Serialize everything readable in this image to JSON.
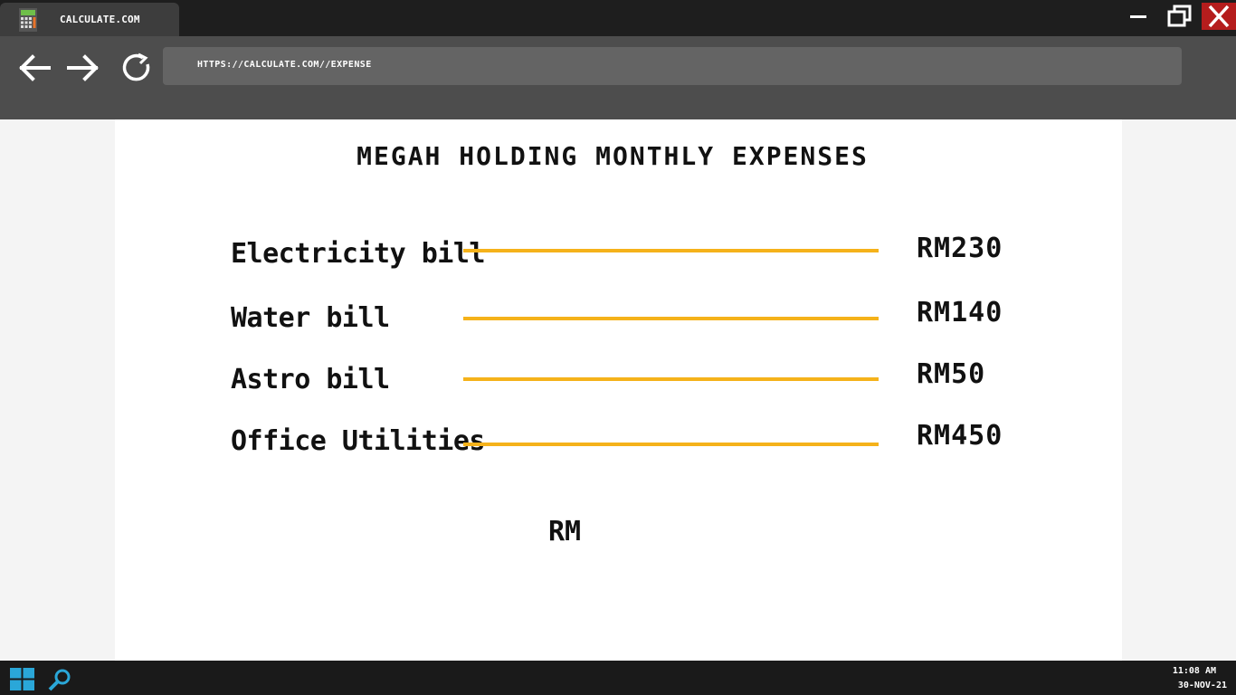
{
  "browser": {
    "tab_title": "CALCULATE.COM",
    "url": "HTTPS://CALCULATE.COM//EXPENSE"
  },
  "page": {
    "title": "MEGAH HOLDING MONTHLY EXPENSES",
    "expenses": [
      {
        "label": "Electricity bill",
        "amount": "RM230"
      },
      {
        "label": "Water bill",
        "amount": "RM140"
      },
      {
        "label": "Astro bill",
        "amount": "RM50"
      },
      {
        "label": "Office Utilities",
        "amount": "RM450"
      }
    ],
    "total_label": "RM"
  },
  "taskbar": {
    "time": "11:08 AM",
    "date": "30-NOV-21"
  },
  "colors": {
    "accent_line": "#f5b21a",
    "close_button": "#b51d1d",
    "taskbar_icons": "#2aa7d8"
  },
  "icons": {
    "tab": "calculator-icon",
    "back": "arrow-left-icon",
    "forward": "arrow-right-icon",
    "reload": "reload-icon",
    "start": "windows-start-icon",
    "search": "search-icon"
  }
}
